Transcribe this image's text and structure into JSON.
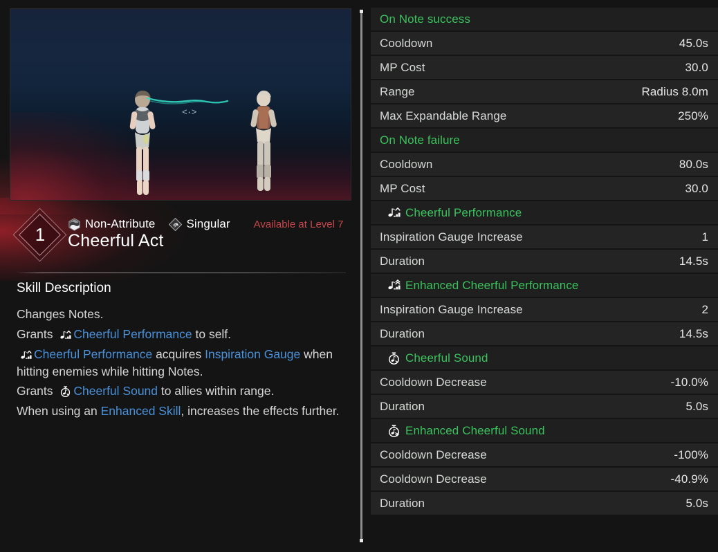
{
  "skill": {
    "level_badge": "1",
    "name": "Cheerful Act",
    "attribute_tag": "Non-Attribute",
    "target_tag": "Singular",
    "availability": "Available at Level 7",
    "attribute_icon": "hexagon-split-icon",
    "target_icon": "diamond-fist-icon",
    "preview_reticle": "<·>"
  },
  "description": {
    "heading": "Skill Description",
    "line1": "Changes Notes.",
    "line2_a": "Grants",
    "line2_link": "Cheerful Performance",
    "line2_b": "to self.",
    "line3_link1": "Cheerful Performance",
    "line3_a": "acquires",
    "line3_link2": "Inspiration Gauge",
    "line3_b": "when hitting enemies while hitting Notes.",
    "line4_a": "Grants",
    "line4_link": "Cheerful Sound",
    "line4_b": "to allies within range.",
    "line5_a": "When using an",
    "line5_link": "Enhanced Skill",
    "line5_b": ", increases the effects further."
  },
  "stats": [
    {
      "type": "section",
      "label": "On Note success",
      "value": ""
    },
    {
      "type": "stat",
      "label": "Cooldown",
      "value": "45.0s"
    },
    {
      "type": "stat",
      "label": "MP Cost",
      "value": "30.0"
    },
    {
      "type": "stat",
      "label": "Range",
      "value": "Radius 8.0m"
    },
    {
      "type": "stat",
      "label": "Max Expandable Range",
      "value": "250%"
    },
    {
      "type": "section",
      "label": "On Note failure",
      "value": ""
    },
    {
      "type": "stat",
      "label": "Cooldown",
      "value": "80.0s"
    },
    {
      "type": "stat",
      "label": "MP Cost",
      "value": "30.0"
    },
    {
      "type": "buff",
      "label": "Cheerful Performance",
      "value": "",
      "icon": "music-note-up-icon"
    },
    {
      "type": "stat",
      "label": "Inspiration Gauge Increase",
      "value": "1"
    },
    {
      "type": "stat",
      "label": "Duration",
      "value": "14.5s"
    },
    {
      "type": "buff",
      "label": "Enhanced Cheerful Performance",
      "value": "",
      "icon": "music-note-double-up-icon"
    },
    {
      "type": "stat",
      "label": "Inspiration Gauge Increase",
      "value": "2"
    },
    {
      "type": "stat",
      "label": "Duration",
      "value": "14.5s"
    },
    {
      "type": "buff",
      "label": "Cheerful Sound",
      "value": "",
      "icon": "stopwatch-note-down-icon"
    },
    {
      "type": "stat",
      "label": "Cooldown Decrease",
      "value": "-10.0%"
    },
    {
      "type": "stat",
      "label": "Duration",
      "value": "5.0s"
    },
    {
      "type": "buff",
      "label": "Enhanced Cheerful Sound",
      "value": "",
      "icon": "stopwatch-note-double-down-icon"
    },
    {
      "type": "stat",
      "label": "Cooldown Decrease",
      "value": "-100%"
    },
    {
      "type": "stat",
      "label": "Cooldown Decrease",
      "value": "-40.9%"
    },
    {
      "type": "stat",
      "label": "Duration",
      "value": "5.0s"
    }
  ],
  "colors": {
    "accent_green": "#3ac25c",
    "link_blue": "#4a90d9",
    "availability_red": "#c8474b",
    "row_bg": "#242424",
    "section_bg": "#1f1f1f",
    "page_bg": "#141414"
  }
}
